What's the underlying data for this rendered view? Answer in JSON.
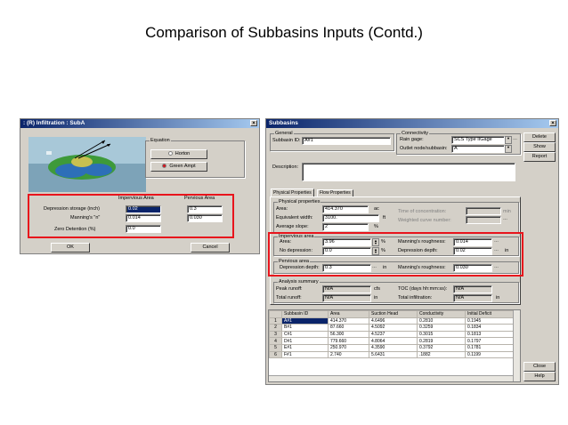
{
  "slide": {
    "title": "Comparison of Subbasins Inputs (Contd.)"
  },
  "infiltration": {
    "title": ": (R) Infiltration : SubA",
    "close": "×",
    "equation_label": "Equation",
    "options": [
      "Horton",
      "Green Ampt"
    ],
    "selected_option": 1,
    "col_impervious": "Impervious Area",
    "col_pervious": "Pervious Area",
    "rows": [
      {
        "label": "Depression storage   (inch)",
        "impervious": "0.02",
        "pervious": "0.3"
      },
      {
        "label": "Manning's \"n\"",
        "impervious": "0.014",
        "pervious": "0.030"
      },
      {
        "label": "Zero Detention (%)",
        "impervious": "0.0",
        "pervious": ""
      }
    ],
    "ok": "OK",
    "cancel": "Cancel"
  },
  "subbasins": {
    "title": "Subbasins",
    "close": "×",
    "general_label": "General",
    "subbasin_id_label": "Subbasin ID:",
    "subbasin_id": "A#1",
    "connectivity_label": "Connectivity",
    "rain_gage_label": "Rain gage:",
    "rain_gage": "SCS Type IIGage",
    "outlet_label": "Outlet node/subbasin:",
    "outlet": "A",
    "description_label": "Description:",
    "description": "",
    "tabs": [
      "Physical Properties",
      "Flow Properties"
    ],
    "physical_label": "Physical properties",
    "area_label": "Area:",
    "area": "414.370",
    "area_unit": "ac",
    "width_label": "Equivalent width:",
    "width": "3100.",
    "width_unit": "ft",
    "slope_label": "Average slope:",
    "slope": "2",
    "slope_unit": "%",
    "toc_label": "Time of concentration:",
    "toc_unit": "min",
    "wcn_label": "Weighted curve number:",
    "impervious_label": "Impervious area",
    "imp_area_label": "Area:",
    "imp_area": "3.96",
    "imp_area_unit": "%",
    "no_dep_label": "No depression:",
    "no_dep": "0.0",
    "no_dep_unit": "%",
    "imp_manning_label": "Manning's roughness:",
    "imp_manning": "0.014",
    "imp_dep_label": "Depression depth:",
    "imp_dep": "0.02",
    "imp_dep_unit": "in",
    "pervious_label": "Pervious area",
    "perv_dep_label": "Depression depth:",
    "perv_dep": "0.3",
    "perv_dep_unit": "in",
    "perv_manning_label": "Manning's roughness:",
    "perv_manning": "0.030",
    "analysis_label": "Analysis summary",
    "peak_runoff_label": "Peak runoff:",
    "peak_runoff": "N/A",
    "peak_runoff_unit": "cfs",
    "total_runoff_label": "Total runoff:",
    "total_runoff": "N/A",
    "total_runoff_unit": "in",
    "toc2_label": "TOC (days hh:mm:ss):",
    "toc2": "N/A",
    "total_infil_label": "Total infiltration:",
    "total_infil": "N/A",
    "total_infil_unit": "in",
    "buttons": [
      "Delete",
      "Show",
      "Report"
    ],
    "close_btn": "Close",
    "help_btn": "Help",
    "table_headers": [
      "Subbasin ID",
      "Area",
      "Suction Head",
      "Conductivity",
      "Initial Deficit"
    ],
    "table_rows": [
      {
        "n": "1",
        "id": "A#1",
        "area": "414.370",
        "suction": "4.6496",
        "cond": "0.2810",
        "deficit": "0.1945"
      },
      {
        "n": "2",
        "id": "B#1",
        "area": "87.660",
        "suction": "4.5092",
        "cond": "0.3259",
        "deficit": "0.1834"
      },
      {
        "n": "3",
        "id": "C#1",
        "area": "56.300",
        "suction": "4.5237",
        "cond": "0.3015",
        "deficit": "0.1813"
      },
      {
        "n": "4",
        "id": "D#1",
        "area": "779.660",
        "suction": "4.8064",
        "cond": "0.2819",
        "deficit": "0.1797"
      },
      {
        "n": "5",
        "id": "E#1",
        "area": "250.970",
        "suction": "4.3590",
        "cond": "0.3792",
        "deficit": "0.1781"
      },
      {
        "n": "6",
        "id": "F#1",
        "area": "2.740",
        "suction": "5.6431",
        "cond": ".1882",
        "deficit": "0.1199"
      }
    ]
  }
}
